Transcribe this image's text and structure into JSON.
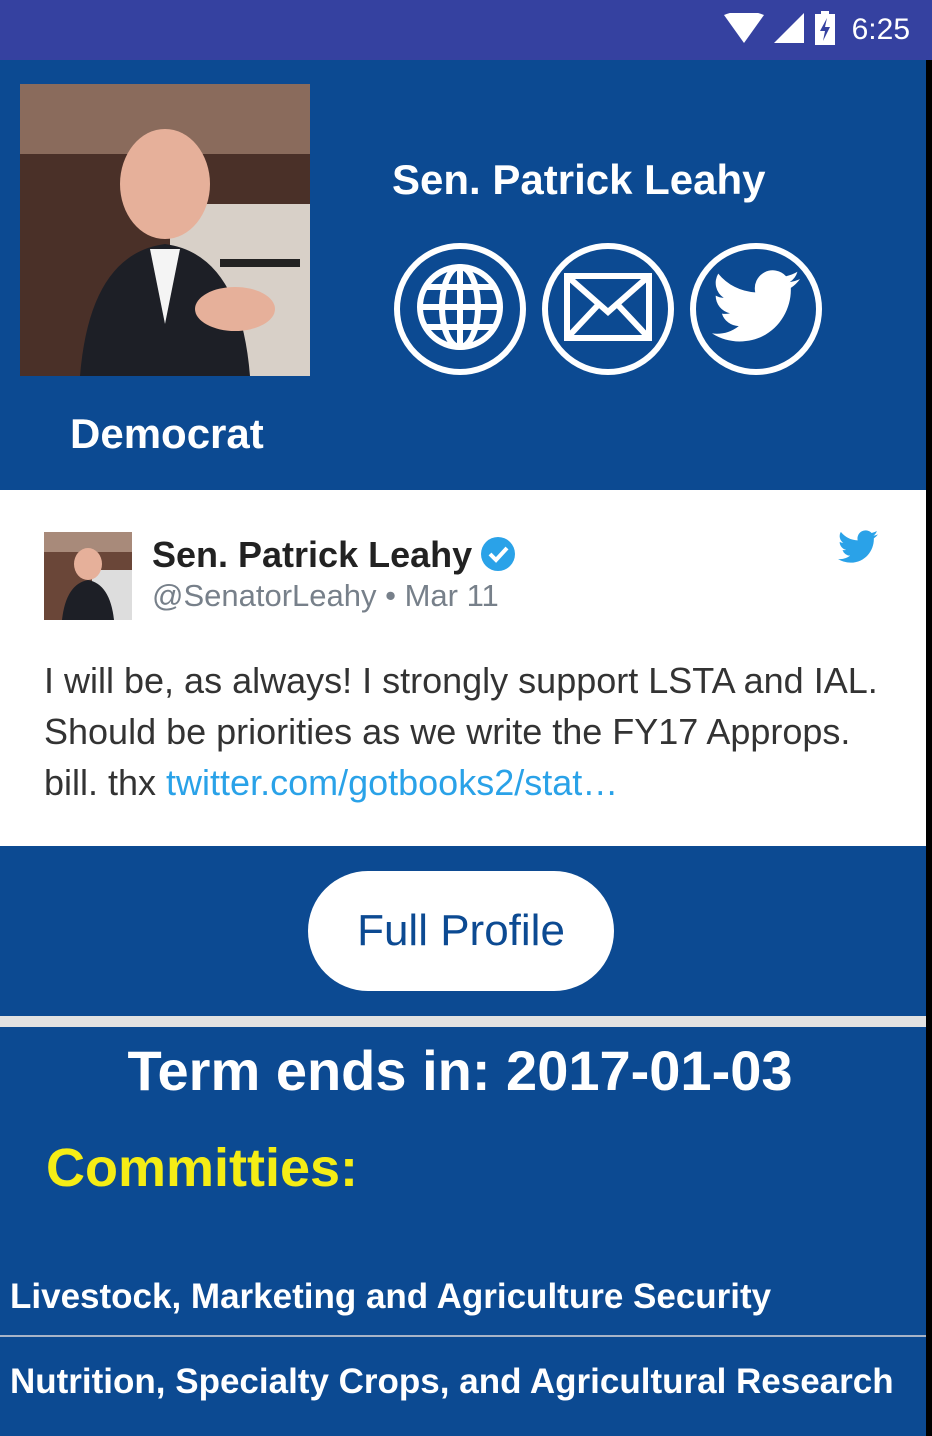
{
  "status_bar": {
    "time": "6:25",
    "icons": [
      "wifi-icon",
      "signal-icon",
      "battery-charging-icon"
    ]
  },
  "header": {
    "name": "Sen. Patrick Leahy",
    "party": "Democrat",
    "links": [
      "globe-icon",
      "mail-icon",
      "twitter-icon"
    ]
  },
  "tweet": {
    "author": "Sen. Patrick Leahy",
    "handle": "@SenatorLeahy",
    "date": "Mar 11",
    "handle_line": "@SenatorLeahy • Mar 11",
    "text": "I will be, as always! I strongly support LSTA and IAL. Should be priorities as we write the FY17 Approps. bill. thx ",
    "link": "twitter.com/gotbooks2/stat…"
  },
  "profile_button": "Full Profile",
  "term": "Term ends in: 2017-01-03",
  "committees_title": "Committies:",
  "committees": [
    "Livestock, Marketing and Agriculture Security",
    "Nutrition, Specialty Crops, and Agricultural Research"
  ],
  "colors": {
    "status_bar": "#3541a0",
    "background": "#0c4a92",
    "accent_yellow": "#f5ed15",
    "twitter_blue": "#2aa2e8"
  }
}
